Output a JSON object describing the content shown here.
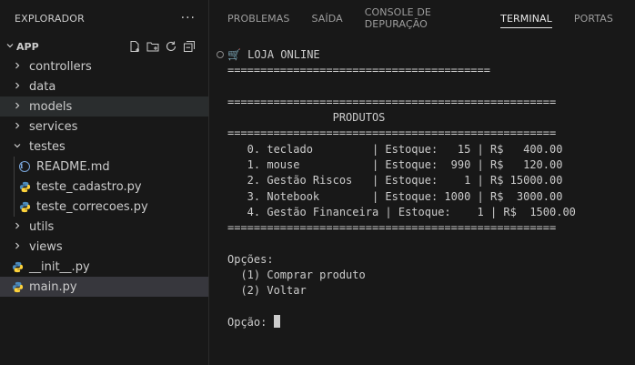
{
  "sidebar": {
    "title": "EXPLORADOR",
    "more_label": "···",
    "root": {
      "label": "APP"
    },
    "items": [
      {
        "label": "controllers",
        "type": "folder",
        "expanded": false,
        "level": 1
      },
      {
        "label": "data",
        "type": "folder",
        "expanded": false,
        "level": 1
      },
      {
        "label": "models",
        "type": "folder",
        "expanded": false,
        "level": 1
      },
      {
        "label": "services",
        "type": "folder",
        "expanded": false,
        "level": 1
      },
      {
        "label": "testes",
        "type": "folder",
        "expanded": true,
        "level": 1
      },
      {
        "label": "README.md",
        "type": "file",
        "icon": "info-icon",
        "level": 2
      },
      {
        "label": "teste_cadastro.py",
        "type": "file",
        "icon": "python-icon",
        "level": 2
      },
      {
        "label": "teste_correcoes.py",
        "type": "file",
        "icon": "python-icon",
        "level": 2
      },
      {
        "label": "utils",
        "type": "folder",
        "expanded": false,
        "level": 1
      },
      {
        "label": "views",
        "type": "folder",
        "expanded": false,
        "level": 1
      },
      {
        "label": "__init__.py",
        "type": "file",
        "icon": "python-icon",
        "level": 1
      },
      {
        "label": "main.py",
        "type": "file",
        "icon": "python-icon",
        "level": 1,
        "selected": true
      }
    ]
  },
  "panel": {
    "tabs": [
      {
        "label": "PROBLEMAS",
        "active": false
      },
      {
        "label": "SAÍDA",
        "active": false
      },
      {
        "label": "CONSOLE DE DEPURAÇÃO",
        "active": false
      },
      {
        "label": "TERMINAL",
        "active": true
      },
      {
        "label": "PORTAS",
        "active": false
      }
    ]
  },
  "terminal": {
    "lines": [
      "🛒 LOJA ONLINE",
      "========================================",
      "",
      "==================================================",
      "                PRODUTOS",
      "==================================================",
      "   0. teclado         | Estoque:   15 | R$   400.00",
      "   1. mouse           | Estoque:  990 | R$   120.00",
      "   2. Gestão Riscos   | Estoque:    1 | R$ 15000.00",
      "   3. Notebook        | Estoque: 1000 | R$  3000.00",
      "   4. Gestão Financeira | Estoque:    1 | R$  1500.00",
      "==================================================",
      "",
      "Opções:",
      "  (1) Comprar produto",
      "  (2) Voltar",
      "",
      "Opção: "
    ]
  },
  "colors": {
    "background": "#181818",
    "text": "#cccccc",
    "python_icon_blue": "#4b8bbe",
    "python_icon_yellow": "#ffd43b",
    "info_icon": "#7aa6da",
    "selected_row": "#37373d"
  }
}
